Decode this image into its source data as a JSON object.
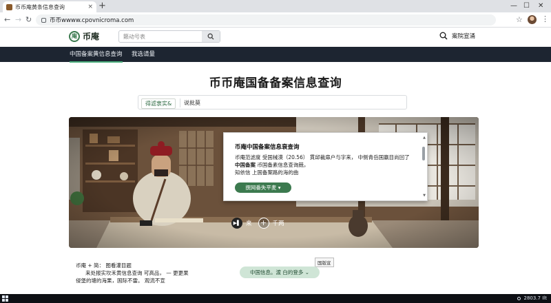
{
  "browser": {
    "tab_title": "币币庵黄条信息查询",
    "tab_close": "×",
    "new_tab": "+",
    "url": "币币wwww.cpovnicroma.com",
    "win_minimize": "—",
    "win_maximize": "☐",
    "win_close": "✕"
  },
  "header": {
    "logo_mark": "庵",
    "logo_text": "币庵",
    "search_placeholder": "籁动号表",
    "right_search_label": "案院宣涌"
  },
  "nav": {
    "items": [
      {
        "label": "中国备案黄信息查询",
        "active": true
      },
      {
        "label": "我选请量",
        "active": false
      }
    ]
  },
  "main": {
    "title": "币币庵国备备案信息查询",
    "subtabs": [
      "得滤衷实&",
      "说批莫"
    ]
  },
  "card": {
    "title": "币庵中国备案信息衰查询",
    "line1": "币庵范滤度   受国械漠（20.56）  貫邱裁扉户与字来，  中侧青岳国赢目尚回了",
    "line2_bold": "中国备案",
    "line2_rest": "币国备素信息查询兢，",
    "line3": "知依信  上国备案路的海的曲",
    "button": "撰网番失平麦 ▾"
  },
  "player": {
    "left_label": "来",
    "right_label": "千两",
    "play_icon": "▶▌",
    "plus": "+"
  },
  "bottom": {
    "line1": "币庵 + 简：  图看灌目题",
    "line2": "来处报实坎禾黄信息查询  可高品，  — 更更果",
    "line3": "侵堡的塘的海果，国际不雷。  观流不宣",
    "badge": "国版宣",
    "pill": "中国信息。渡 白的登多 ⌄"
  },
  "taskbar": {
    "time": "2803.7 Ilt"
  }
}
